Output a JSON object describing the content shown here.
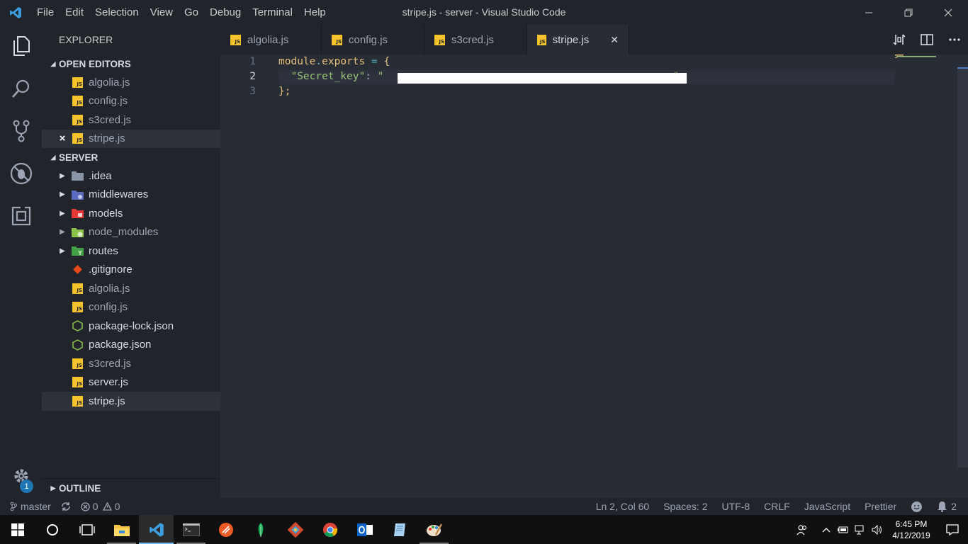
{
  "titlebar": {
    "menu": [
      "File",
      "Edit",
      "Selection",
      "View",
      "Go",
      "Debug",
      "Terminal",
      "Help"
    ],
    "title": "stripe.js - server - Visual Studio Code"
  },
  "activitybar": {
    "icons": [
      "files-icon",
      "search-icon",
      "source-control-icon",
      "debug-icon",
      "extensions-icon"
    ],
    "settings_badge": "1"
  },
  "sidebar": {
    "title": "EXPLORER",
    "open_editors": {
      "heading": "OPEN EDITORS",
      "files": [
        {
          "name": "algolia.js"
        },
        {
          "name": "config.js"
        },
        {
          "name": "s3cred.js"
        },
        {
          "name": "stripe.js",
          "close": "×"
        }
      ]
    },
    "server": {
      "heading": "SERVER",
      "folders": [
        {
          "name": ".idea",
          "icon": "folder-idea-icon",
          "color": "#8a96a8"
        },
        {
          "name": "middlewares",
          "icon": "folder-middleware-icon",
          "color": "#5c6bc0"
        },
        {
          "name": "models",
          "icon": "folder-models-icon",
          "color": "#e53935"
        },
        {
          "name": "node_modules",
          "icon": "folder-node-icon",
          "color": "#8bc34a"
        },
        {
          "name": "routes",
          "icon": "folder-routes-icon",
          "color": "#43a047"
        }
      ],
      "files": [
        {
          "name": ".gitignore",
          "icon": "git-icon"
        },
        {
          "name": "algolia.js",
          "icon": "js-file-icon"
        },
        {
          "name": "config.js",
          "icon": "js-file-icon"
        },
        {
          "name": "package-lock.json",
          "icon": "nodejs-icon"
        },
        {
          "name": "package.json",
          "icon": "nodejs-icon"
        },
        {
          "name": "s3cred.js",
          "icon": "js-file-icon"
        },
        {
          "name": "server.js",
          "icon": "js-file-icon"
        },
        {
          "name": "stripe.js",
          "icon": "js-file-icon"
        }
      ]
    },
    "outline": "OUTLINE"
  },
  "tabs": [
    {
      "label": "algolia.js"
    },
    {
      "label": "config.js"
    },
    {
      "label": "s3cred.js"
    },
    {
      "label": "stripe.js",
      "close": "✕"
    }
  ],
  "editor": {
    "line_numbers": [
      "1",
      "2",
      "3"
    ],
    "line1": {
      "module": "module",
      "dot": ".",
      "exports": "exports",
      "eq": " = ",
      "brace": "{"
    },
    "line2": {
      "indent": "  ",
      "key": "\"Secret_key\"",
      "colon": ": ",
      "open_quote": "\"",
      "close_quote": "\""
    },
    "line3": {
      "close": "};"
    }
  },
  "statusbar": {
    "branch": "master",
    "errors": "0",
    "warnings": "0",
    "position": "Ln 2, Col 60",
    "spaces": "Spaces: 2",
    "encoding": "UTF-8",
    "eol": "CRLF",
    "language": "JavaScript",
    "formatter": "Prettier",
    "notifications": "2"
  },
  "taskbar": {
    "time": "6:45 PM",
    "date": "4/12/2019"
  },
  "colors": {
    "accent": "#1f76b5",
    "js_yellow": "#f5c42c",
    "string_green": "#98c379"
  }
}
